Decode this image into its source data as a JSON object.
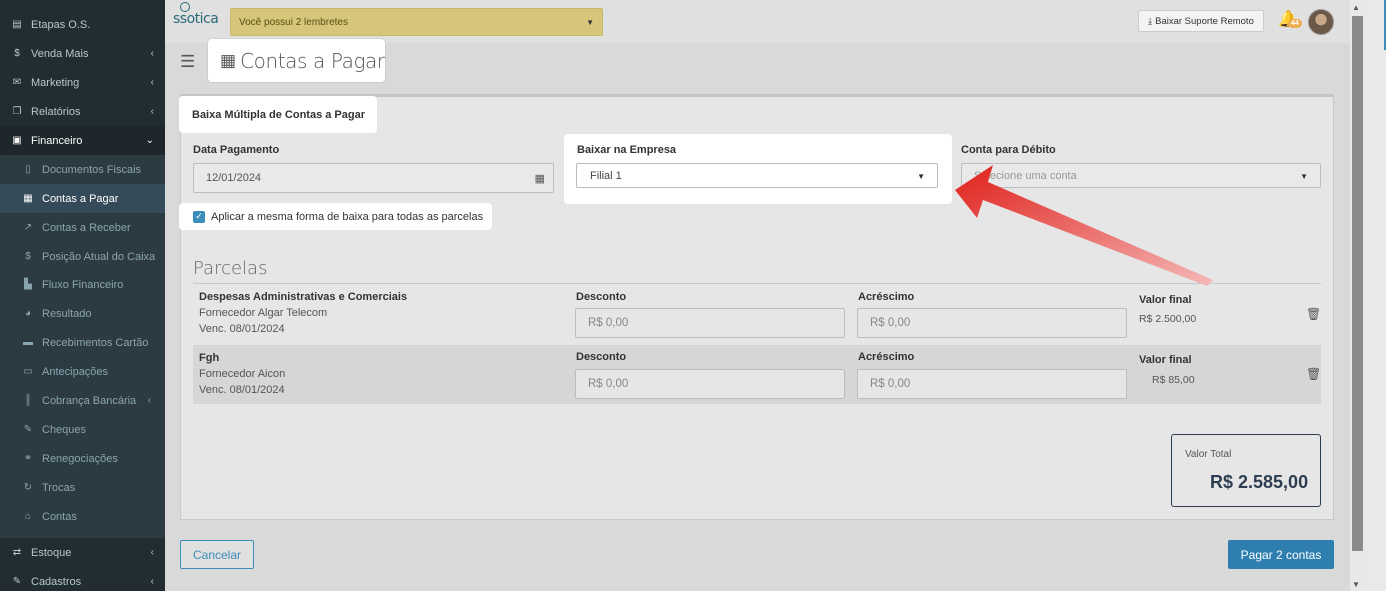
{
  "sidebar": {
    "items": [
      {
        "label": "Etapas O.S.",
        "icon": "list-icon",
        "chev": ""
      },
      {
        "label": "Venda Mais",
        "icon": "dollar-icon",
        "chev": "‹"
      },
      {
        "label": "Marketing",
        "icon": "chat-icon",
        "chev": "‹"
      },
      {
        "label": "Relatórios",
        "icon": "copy-icon",
        "chev": "‹"
      },
      {
        "label": "Financeiro",
        "icon": "money-icon",
        "chev": "⌄"
      }
    ],
    "sub_items": [
      {
        "label": "Documentos Fiscais",
        "icon": "document-icon"
      },
      {
        "label": "Contas a Pagar",
        "icon": "calculator-icon"
      },
      {
        "label": "Contas a Receber",
        "icon": "chart-line-icon"
      },
      {
        "label": "Posição Atual do Caixa",
        "icon": "dollar-icon"
      },
      {
        "label": "Fluxo Financeiro",
        "icon": "area-chart-icon"
      },
      {
        "label": "Resultado",
        "icon": "pie-chart-icon"
      },
      {
        "label": "Recebimentos Cartão",
        "icon": "credit-card-icon"
      },
      {
        "label": "Antecipações",
        "icon": "card-icon"
      },
      {
        "label": "Cobrança Bancária",
        "icon": "barcode-icon"
      },
      {
        "label": "Cheques",
        "icon": "edit-icon"
      },
      {
        "label": "Renegociações",
        "icon": "handshake-icon"
      },
      {
        "label": "Trocas",
        "icon": "refresh-icon"
      },
      {
        "label": "Contas",
        "icon": "bank-icon"
      }
    ],
    "bottom_items": [
      {
        "label": "Estoque",
        "icon": "exchange-icon",
        "chev": "‹"
      },
      {
        "label": "Cadastros",
        "icon": "edit-icon",
        "chev": "‹"
      }
    ]
  },
  "topbar": {
    "logo": "ssotica",
    "reminder_prefix": "Você possui ",
    "reminder_count": "2 lembretes",
    "support_button": "Baixar Suporte Remoto",
    "notification_count": "44"
  },
  "page": {
    "title": "Contas a Pagar"
  },
  "form": {
    "section_title": "Baixa Múltipla de Contas a Pagar",
    "data_pagamento_label": "Data Pagamento",
    "data_pagamento_value": "12/01/2024",
    "empresa_label": "Baixar na Empresa",
    "empresa_value": "Filial 1",
    "conta_label": "Conta para Débito",
    "conta_placeholder": "Selecione uma conta",
    "checkbox_label": "Aplicar a mesma forma de baixa para todas as parcelas",
    "checkbox_checked": true
  },
  "parcelas": {
    "title": "Parcelas",
    "desconto_label": "Desconto",
    "acrescimo_label": "Acréscimo",
    "valor_final_label": "Valor final",
    "rows": [
      {
        "title": "Despesas Administrativas e Comerciais",
        "fornecedor": "Fornecedor Algar Telecom",
        "vencimento": "Venc. 08/01/2024",
        "desconto": "R$ 0,00",
        "acrescimo": "R$ 0,00",
        "valor_final": "R$ 2.500,00"
      },
      {
        "title": "Fgh",
        "fornecedor": "Fornecedor Aicon",
        "vencimento": "Venc. 08/01/2024",
        "desconto": "R$ 0,00",
        "acrescimo": "R$ 0,00",
        "valor_final": "R$ 85,00"
      }
    ]
  },
  "totals": {
    "label": "Valor Total",
    "value": "R$ 2.585,00"
  },
  "actions": {
    "cancel": "Cancelar",
    "pay": "Pagar 2 contas"
  },
  "colors": {
    "sidebar_bg": "#222d32",
    "accent": "#3c8dbc",
    "pay_button": "#2e7fb0",
    "reminder_bg": "#d6c67a",
    "annotation_arrow": "#e0201b"
  }
}
